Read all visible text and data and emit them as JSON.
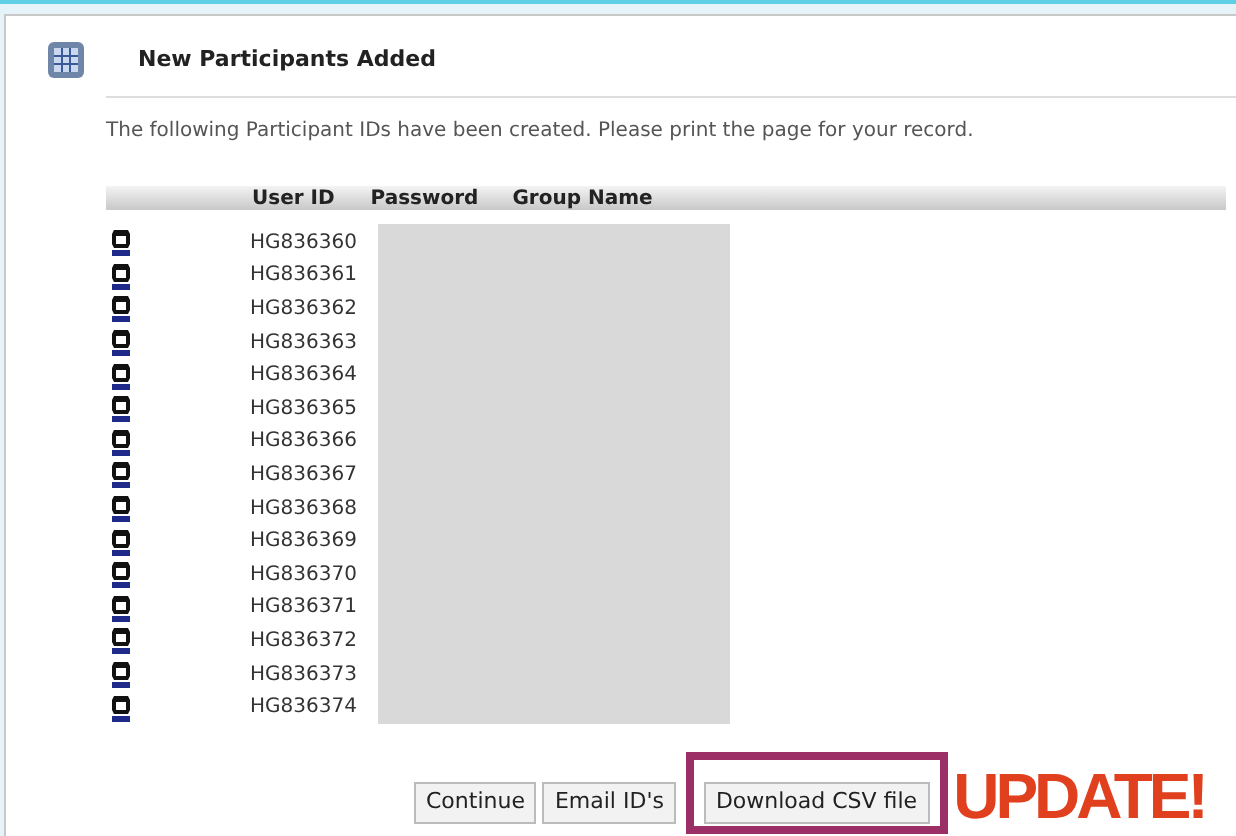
{
  "title": "New Participants Added",
  "message": "The following Participant IDs have been created. Please print the page for your record.",
  "table": {
    "columns": [
      "User ID",
      "Password",
      "Group Name"
    ],
    "rows": [
      "HG836360",
      "HG836361",
      "HG836362",
      "HG836363",
      "HG836364",
      "HG836365",
      "HG836366",
      "HG836367",
      "HG836368",
      "HG836369",
      "HG836370",
      "HG836371",
      "HG836372",
      "HG836373",
      "HG836374"
    ]
  },
  "buttons": [
    {
      "label": "Continue",
      "highlighted": false
    },
    {
      "label": "Email ID's",
      "highlighted": false
    },
    {
      "label": "Download CSV file",
      "highlighted": true
    }
  ],
  "annotation": "UPDATE!"
}
